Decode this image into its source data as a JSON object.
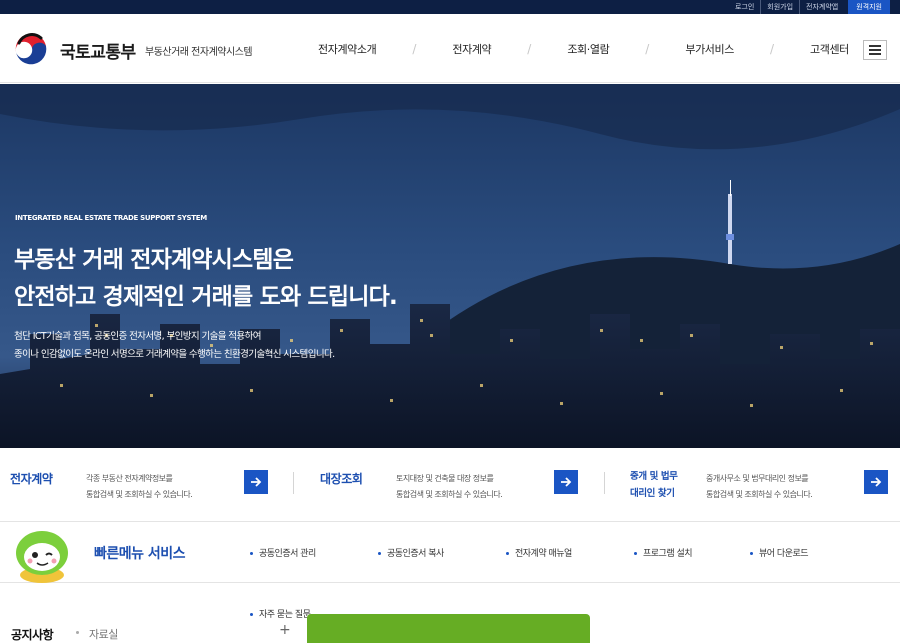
{
  "utility": {
    "links": [
      "로그인",
      "회원가입",
      "전자계약앱",
      "원격지원"
    ]
  },
  "header": {
    "logo_name": "국토교통부",
    "logo_sub": "부동산거래 전자계약시스템",
    "nav": [
      "전자계약소개",
      "전자계약",
      "조회·열람",
      "부가서비스",
      "고객센터"
    ]
  },
  "hero": {
    "eyebrow": "INTEGRATED REAL ESTATE TRADE SUPPORT SYSTEM",
    "title_line1": "부동산 거래 전자계약시스템은",
    "title_line2": "안전하고 경제적인 거래를 도와 드립니다.",
    "desc_line1": "첨단 ICT기술과 접목, 공동인증 전자서명, 부인방지 기술을 적용하여",
    "desc_line2": "종이나 인감없이도 온라인 서명으로 거래계약을 수행하는 친환경기술혁신 시스템입니다."
  },
  "quick_boxes": [
    {
      "title": "전자계약",
      "desc1": "각종 부동산 전자계약정보를",
      "desc2": "통합검색 및 조회하실 수 있습니다."
    },
    {
      "title": "대장조회",
      "desc1": "토지대장 및 건축물 대장 정보를",
      "desc2": "통합검색 및 조회하실 수 있습니다."
    },
    {
      "title1": "중개 및 법무",
      "title2": "대리인 찾기",
      "desc1": "중개사무소 및 법무대리인 정보를",
      "desc2": "통합검색 및 조회하실 수 있습니다."
    }
  ],
  "quick_menu": {
    "title": "빠른메뉴 서비스",
    "links": [
      "공동인증서 관리",
      "공동인증서 복사",
      "전자계약 매뉴얼",
      "프로그램 설치",
      "뷰어 다운로드",
      "자주 묻는 질문"
    ]
  },
  "notice": {
    "active_tab": "공지사항",
    "inactive_tab": "자료실",
    "more": "+"
  },
  "colors": {
    "brand_blue": "#1a55c4",
    "title_blue": "#1d4fb0",
    "util_bar": "#0d1f44",
    "green_panel": "#66ad24"
  },
  "icons": {
    "logo": "taegeuk-logo-icon",
    "menu": "hamburger-icon",
    "arrow": "arrow-right-icon",
    "mascot": "mascot-icon"
  }
}
